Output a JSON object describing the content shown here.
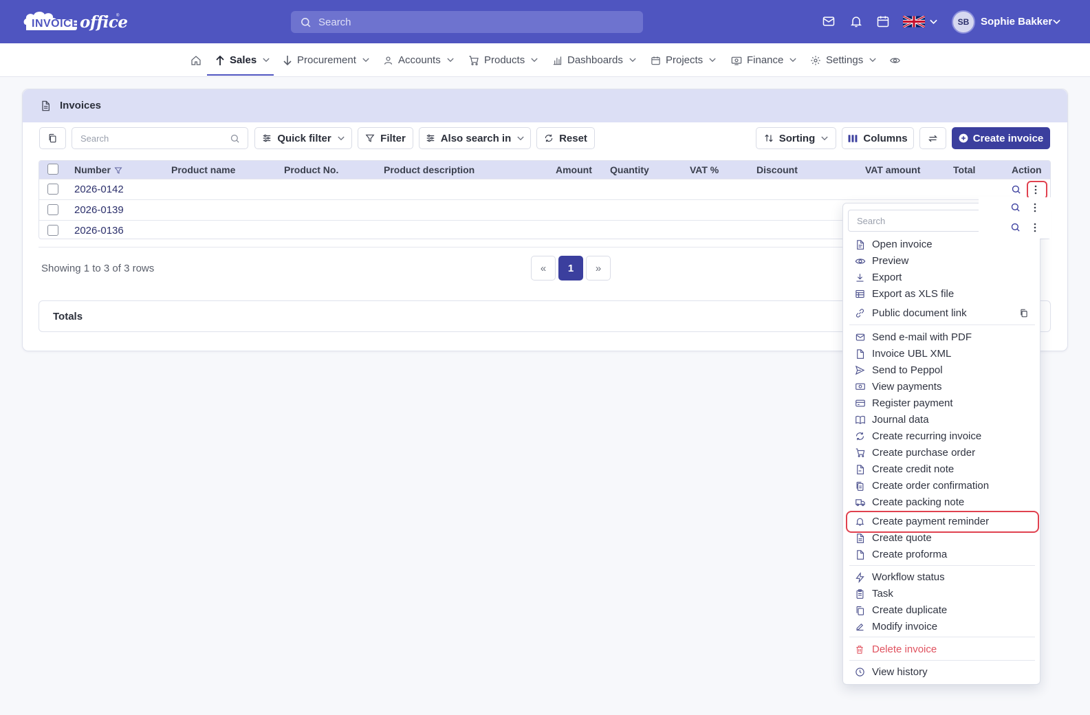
{
  "app": {
    "brand": "INVOICE",
    "brand_suffix": "office",
    "search_placeholder": "Search",
    "user_initials": "SB",
    "user_name": "Sophie Bakker",
    "accent": "#4f55c0",
    "primary_button": "#3b3f9e"
  },
  "nav": {
    "items": [
      {
        "label": "Sales",
        "icon": "arrow-up-icon"
      },
      {
        "label": "Procurement",
        "icon": "arrow-down-icon"
      },
      {
        "label": "Accounts",
        "icon": "user-icon"
      },
      {
        "label": "Products",
        "icon": "cart-icon"
      },
      {
        "label": "Dashboards",
        "icon": "bar-chart-icon"
      },
      {
        "label": "Projects",
        "icon": "calendar-icon"
      },
      {
        "label": "Finance",
        "icon": "money-icon"
      },
      {
        "label": "Settings",
        "icon": "gear-icon"
      }
    ]
  },
  "page": {
    "title": "Invoices"
  },
  "toolbar": {
    "search_placeholder": "Search",
    "quick_filter": "Quick filter",
    "filter": "Filter",
    "also_search_in": "Also search in",
    "reset": "Reset",
    "sorting": "Sorting",
    "columns": "Columns",
    "create_invoice": "Create invoice"
  },
  "table": {
    "columns": [
      "Number",
      "Product name",
      "Product No.",
      "Product description",
      "Amount",
      "Quantity",
      "VAT %",
      "Discount",
      "VAT amount",
      "Total",
      "Action"
    ],
    "rows": [
      {
        "number": "2026-0142"
      },
      {
        "number": "2026-0139"
      },
      {
        "number": "2026-0136"
      }
    ]
  },
  "pagination": {
    "showing": "Showing 1 to 3 of 3 rows",
    "prev": "«",
    "current": "1",
    "next": "»"
  },
  "totals": {
    "label": "Totals"
  },
  "menu": {
    "search_placeholder": "Search",
    "items": [
      {
        "label": "Open invoice",
        "icon": "file-icon"
      },
      {
        "label": "Preview",
        "icon": "eye-icon"
      },
      {
        "label": "Export",
        "icon": "download-icon"
      },
      {
        "label": "Export as XLS file",
        "icon": "table-icon"
      },
      {
        "label": "Public document link",
        "icon": "link-icon"
      },
      {
        "label": "Send e-mail with PDF",
        "icon": "mail-icon"
      },
      {
        "label": "Invoice UBL XML",
        "icon": "file-icon"
      },
      {
        "label": "Send to Peppol",
        "icon": "send-icon"
      },
      {
        "label": "View payments",
        "icon": "money-icon"
      },
      {
        "label": "Register payment",
        "icon": "card-icon"
      },
      {
        "label": "Journal data",
        "icon": "book-icon"
      },
      {
        "label": "Create recurring invoice",
        "icon": "refresh-icon"
      },
      {
        "label": "Create purchase order",
        "icon": "cart-icon"
      },
      {
        "label": "Create credit note",
        "icon": "file-minus-icon"
      },
      {
        "label": "Create order confirmation",
        "icon": "files-icon"
      },
      {
        "label": "Create packing note",
        "icon": "truck-icon"
      },
      {
        "label": "Create payment reminder",
        "icon": "bell-icon"
      },
      {
        "label": "Create quote",
        "icon": "file-text-icon"
      },
      {
        "label": "Create proforma",
        "icon": "file-icon"
      },
      {
        "label": "Workflow status",
        "icon": "bolt-icon"
      },
      {
        "label": "Task",
        "icon": "clipboard-icon"
      },
      {
        "label": "Create duplicate",
        "icon": "copy-icon"
      },
      {
        "label": "Modify invoice",
        "icon": "edit-icon"
      },
      {
        "label": "Delete invoice",
        "icon": "trash-icon"
      },
      {
        "label": "View history",
        "icon": "clock-icon"
      }
    ],
    "danger_color": "#e0525f",
    "highlight_color": "#e0414f"
  }
}
